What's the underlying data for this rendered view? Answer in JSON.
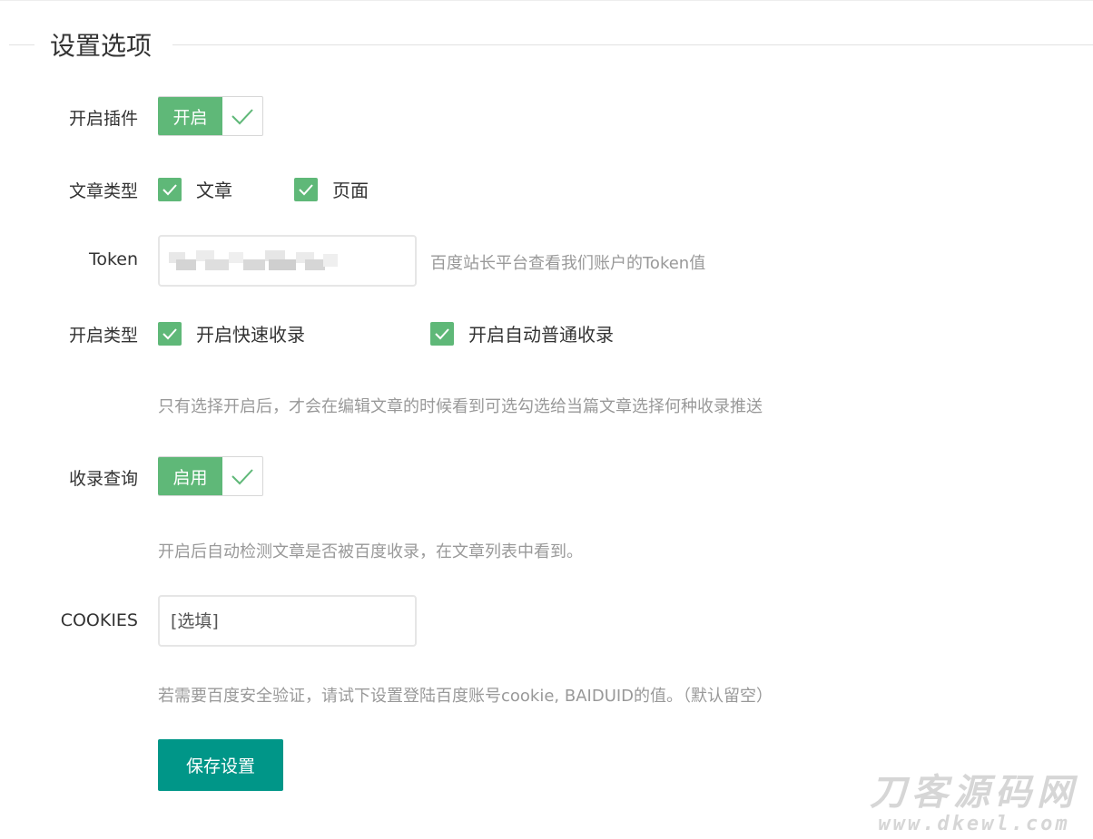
{
  "section": {
    "title": "设置选项"
  },
  "plugin": {
    "label": "开启插件",
    "switch_text": "开启",
    "enabled": true
  },
  "post_types": {
    "label": "文章类型",
    "options": [
      {
        "label": "文章",
        "checked": true
      },
      {
        "label": "页面",
        "checked": true
      }
    ]
  },
  "token": {
    "label": "Token",
    "value": "",
    "hint": "百度站长平台查看我们账户的Token值"
  },
  "submit_types": {
    "label": "开启类型",
    "options": [
      {
        "label": "开启快速收录",
        "checked": true
      },
      {
        "label": "开启自动普通收录",
        "checked": true
      }
    ],
    "hint": "只有选择开启后，才会在编辑文章的时候看到可选勾选给当篇文章选择何种收录推送"
  },
  "index_query": {
    "label": "收录查询",
    "switch_text": "启用",
    "enabled": true,
    "hint": "开启后自动检测文章是否被百度收录，在文章列表中看到。"
  },
  "cookies": {
    "label": "COOKIES",
    "placeholder": "[选填]",
    "hint": "若需要百度安全验证，请试下设置登陆百度账号cookie, BAIDUID的值。（默认留空）"
  },
  "save_label": "保存设置",
  "watermark": {
    "cn": "刀客源码网",
    "en": "www.dkewl.com"
  },
  "colors": {
    "switch_on": "#5fb878",
    "checkbox": "#5fb878",
    "primary_button": "#009688",
    "hint_text": "#999999"
  }
}
